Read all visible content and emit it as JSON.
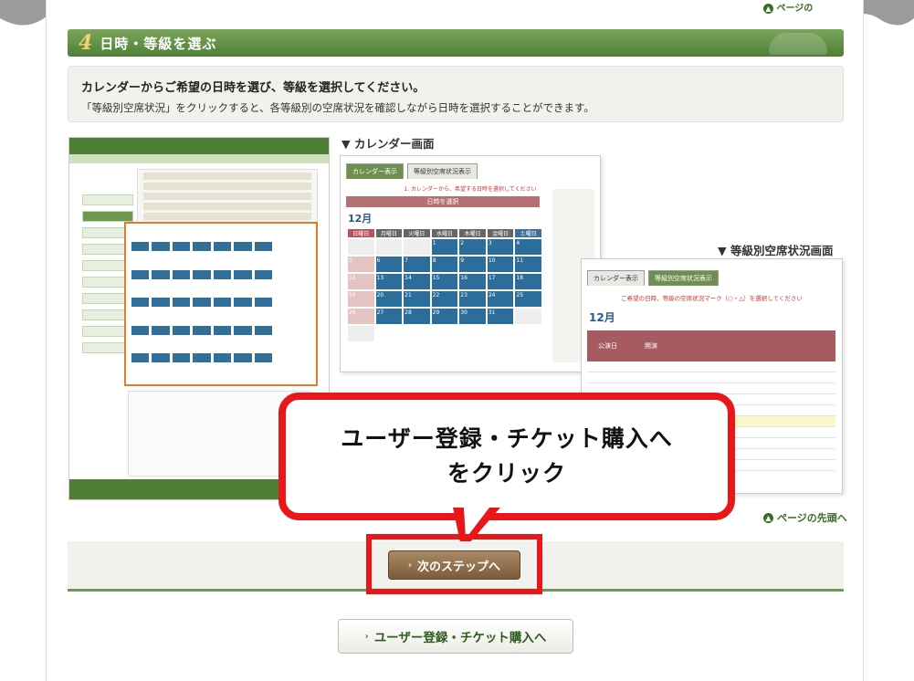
{
  "header": {
    "page_top_small": "ページの",
    "step_number": "4",
    "section_title": "日時・等級を選ぶ"
  },
  "instructions": {
    "heading": "カレンダーからご希望の日時を選び、等級を選択してください。",
    "body": "「等級別空席状況」をクリックすると、各等級別の空席状況を確認しながら日時を選択することができます。"
  },
  "labels": {
    "calendar_screen": "▼ カレンダー画面",
    "availability_screen": "▼ 等級別空席状況画面"
  },
  "calendar_preview": {
    "tab_calendar": "カレンダー表示",
    "tab_availability": "等級別空席状況表示",
    "note": "1. カレンダーから、希望する日時を選択してください",
    "select_date": "日時を選択",
    "month": "12月",
    "weekdays": [
      "日曜日",
      "月曜日",
      "火曜日",
      "水曜日",
      "木曜日",
      "金曜日",
      "土曜日"
    ],
    "days": [
      "",
      "",
      "",
      "1",
      "2",
      "3",
      "4",
      "5",
      "6",
      "7",
      "8",
      "9",
      "10",
      "11",
      "12",
      "13",
      "14",
      "15",
      "16",
      "17",
      "18",
      "19",
      "20",
      "21",
      "22",
      "23",
      "24",
      "25",
      "26",
      "27",
      "28",
      "29",
      "30",
      "31",
      "",
      ""
    ]
  },
  "availability_preview": {
    "tab_calendar": "カレンダー表示",
    "tab_availability": "等級別空席状況表示",
    "note": "ご希望の日時、等級の空席状況マーク（○・△）を選択してください",
    "month": "12月",
    "col_date": "公演日",
    "col_time": "開演"
  },
  "callout": {
    "line1": "ユーザー登録・チケット購入へ",
    "line2": "をクリック"
  },
  "page_top_link": "ページの先頭へ",
  "buttons": {
    "next_step": "次のステップへ",
    "register_purchase": "ユーザー登録・チケット購入へ"
  }
}
